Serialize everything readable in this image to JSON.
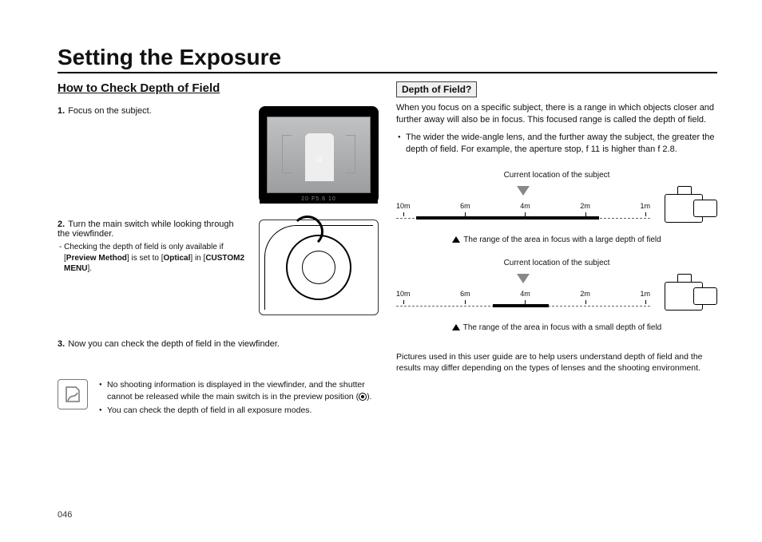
{
  "title": "Setting the Exposure",
  "left": {
    "subhead": "How to Check Depth of Field",
    "steps": {
      "s1": {
        "num": "1.",
        "text": "Focus on the subject."
      },
      "s2": {
        "num": "2.",
        "text": "Turn the main switch while looking through the viewfinder.",
        "note_parts": {
          "a": "- Checking the depth of field is only available if [",
          "b": "Preview Method",
          "c": "] is set to [",
          "d": "Optical",
          "e": "] in [",
          "f": "CUSTOM2 MENU",
          "g": "]."
        }
      },
      "s3": {
        "num": "3.",
        "text": "Now you can check the depth of field in the viewfinder."
      }
    },
    "notes": {
      "n1a": "No shooting information is displayed in the viewfinder, and the shutter cannot be released while the main switch is in the preview position (",
      "n1b": ").",
      "n2": "You can check the depth of field in all exposure modes."
    },
    "lcd_bar": "20  F5.6      10"
  },
  "right": {
    "dof_head": "Depth of Field?",
    "para": "When you focus on a specific subject, there is a range in which objects closer and further away will also be in focus. This focused range is called the depth of field.",
    "bullet": "The wider the wide-angle lens, and the further away the subject, the greater the depth of field. For example, the aperture stop, f 11 is higher than f 2.8.",
    "diag_top": "Current location of the subject",
    "ticks": {
      "t1": "10m",
      "t2": "6m",
      "t3": "4m",
      "t4": "2m",
      "t5": "1m"
    },
    "caption_large": "The range of the area in focus with a large depth of field",
    "caption_small": "The range of the area in focus with a small depth of field",
    "endpara": "Pictures used in this user guide are to help users understand depth of field and the results may differ depending on the types of lenses and the shooting environment."
  },
  "page_num": "046"
}
